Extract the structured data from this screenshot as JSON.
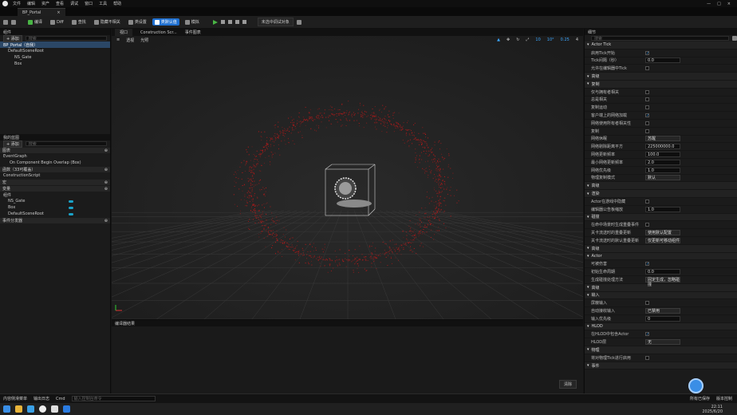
{
  "menu": [
    "文件",
    "编辑",
    "资产",
    "查看",
    "调试",
    "窗口",
    "工具",
    "帮助"
  ],
  "tab": {
    "title": "BP_Portal",
    "close": "×"
  },
  "window_controls": [
    "—",
    "□",
    "×"
  ],
  "toolbar": {
    "compile": "编译",
    "diff": "Diff",
    "find": "查找",
    "hide_unrelated": "隐藏不相关",
    "class_settings": "类设置",
    "class_defaults": "类默认值",
    "simulate": "模拟",
    "debug_target": "未选中调试对象"
  },
  "components": {
    "header": "组件",
    "add": "+ 添加",
    "search_placeholder": "搜索",
    "items": [
      "BP_Portal（自我）",
      "DefaultSceneRoot",
      "NS_Gate",
      "Box"
    ]
  },
  "my_blueprint": {
    "header": "我的蓝图",
    "add": "+ 添加",
    "search_placeholder": "搜索",
    "graphs_label": "图表",
    "event_graph": "EventGraph",
    "event_node": "On Component Begin Overlap (Box)",
    "functions_label": "函数（33可覆盖）",
    "construction": "ConstructionScript",
    "macros_label": "宏",
    "variables_label": "变量",
    "components_label": "组件",
    "vars": [
      "NS_Gate",
      "Box",
      "DefaultSceneRoot"
    ],
    "dispatchers_label": "事件分发器"
  },
  "viewport": {
    "tabs": [
      "视口",
      "Construction Scr...",
      "事件图表"
    ],
    "mode_left": "透视",
    "mode_right": "光照",
    "snap_values": [
      "10",
      "10°",
      "0.25",
      "4"
    ],
    "output_tab": "编译器结果",
    "clear_btn": "清除"
  },
  "details": {
    "header": "细节",
    "search_placeholder": "搜索",
    "sections": [
      {
        "type": "cat",
        "label": "Actor Tick"
      },
      {
        "type": "prop",
        "label": "启用Tick开始",
        "ctrl": "check",
        "value": "✓"
      },
      {
        "type": "prop",
        "label": "Tick间隔（秒）",
        "ctrl": "field",
        "value": "0.0"
      },
      {
        "type": "prop",
        "label": "允许在编辑器中Tick",
        "ctrl": "check",
        "value": ""
      },
      {
        "type": "cat",
        "label": "高级"
      },
      {
        "type": "cat",
        "label": "复制"
      },
      {
        "type": "prop",
        "label": "仅与拥有者相关",
        "ctrl": "check",
        "value": ""
      },
      {
        "type": "prop",
        "label": "总是相关",
        "ctrl": "check",
        "value": ""
      },
      {
        "type": "prop",
        "label": "复制运动",
        "ctrl": "check",
        "value": ""
      },
      {
        "type": "prop",
        "label": "客户端上的网络加载",
        "ctrl": "check",
        "value": "✓"
      },
      {
        "type": "prop",
        "label": "网络使用所有者相关性",
        "ctrl": "check",
        "value": ""
      },
      {
        "type": "prop",
        "label": "复制",
        "ctrl": "check",
        "value": ""
      },
      {
        "type": "prop",
        "label": "网络休眠",
        "ctrl": "drop",
        "value": "苏醒"
      },
      {
        "type": "prop",
        "label": "网络剔除距离平方",
        "ctrl": "field",
        "value": "225000000.0"
      },
      {
        "type": "prop",
        "label": "网络更新频率",
        "ctrl": "field",
        "value": "100.0"
      },
      {
        "type": "prop",
        "label": "最小网络更新频率",
        "ctrl": "field",
        "value": "2.0"
      },
      {
        "type": "prop",
        "label": "网络优先级",
        "ctrl": "field",
        "value": "1.0"
      },
      {
        "type": "prop",
        "label": "物理复制模式",
        "ctrl": "drop",
        "value": "默认"
      },
      {
        "type": "cat",
        "label": "高级"
      },
      {
        "type": "cat",
        "label": "渲染"
      },
      {
        "type": "prop",
        "label": "Actor在游戏中隐藏",
        "ctrl": "check",
        "value": ""
      },
      {
        "type": "prop",
        "label": "编辑器公告板缩放",
        "ctrl": "field",
        "value": "1.0"
      },
      {
        "type": "cat",
        "label": "碰撞"
      },
      {
        "type": "prop",
        "label": "在命中场景时生成重叠事件",
        "ctrl": "check",
        "value": ""
      },
      {
        "type": "prop",
        "label": "关卡流送时的重叠更新",
        "ctrl": "drop",
        "value": "使用默认配置"
      },
      {
        "type": "prop",
        "label": "关卡流送时的默认重叠更新",
        "ctrl": "drop",
        "value": "仅更新可移动组件"
      },
      {
        "type": "cat",
        "label": "高级"
      },
      {
        "type": "cat",
        "label": "Actor"
      },
      {
        "type": "prop",
        "label": "可被伤害",
        "ctrl": "check",
        "value": "✓"
      },
      {
        "type": "prop",
        "label": "初始生命周期",
        "ctrl": "field",
        "value": "0.0"
      },
      {
        "type": "prop",
        "label": "生成碰撞处理方法",
        "ctrl": "drop",
        "value": "固定生成，忽略碰撞"
      },
      {
        "type": "cat",
        "label": "高级"
      },
      {
        "type": "cat",
        "label": "输入"
      },
      {
        "type": "prop",
        "label": "屏蔽输入",
        "ctrl": "check",
        "value": ""
      },
      {
        "type": "prop",
        "label": "自动接收输入",
        "ctrl": "drop",
        "value": "已禁用"
      },
      {
        "type": "prop",
        "label": "输入优先级",
        "ctrl": "field",
        "value": "0"
      },
      {
        "type": "cat",
        "label": "HLOD"
      },
      {
        "type": "prop",
        "label": "在HLOD中包含Actor",
        "ctrl": "check",
        "value": "✓"
      },
      {
        "type": "prop",
        "label": "HLOD层",
        "ctrl": "drop",
        "value": "无"
      },
      {
        "type": "cat",
        "label": "物理"
      },
      {
        "type": "prop",
        "label": "将对物理Tick进行启用",
        "ctrl": "check",
        "value": ""
      },
      {
        "type": "cat",
        "label": "事件"
      }
    ]
  },
  "status": {
    "drawer": "内容侧滑菜单",
    "output": "输出日志",
    "cmd": "Cmd",
    "cmd_placeholder": "输入控制台命令",
    "saved": "所有已保存",
    "source": "版本控制"
  },
  "clock": {
    "time": "22:11",
    "date": "2025/6/20"
  },
  "colors": {
    "accent": "#1e6fd0",
    "particle": "#c21818"
  }
}
